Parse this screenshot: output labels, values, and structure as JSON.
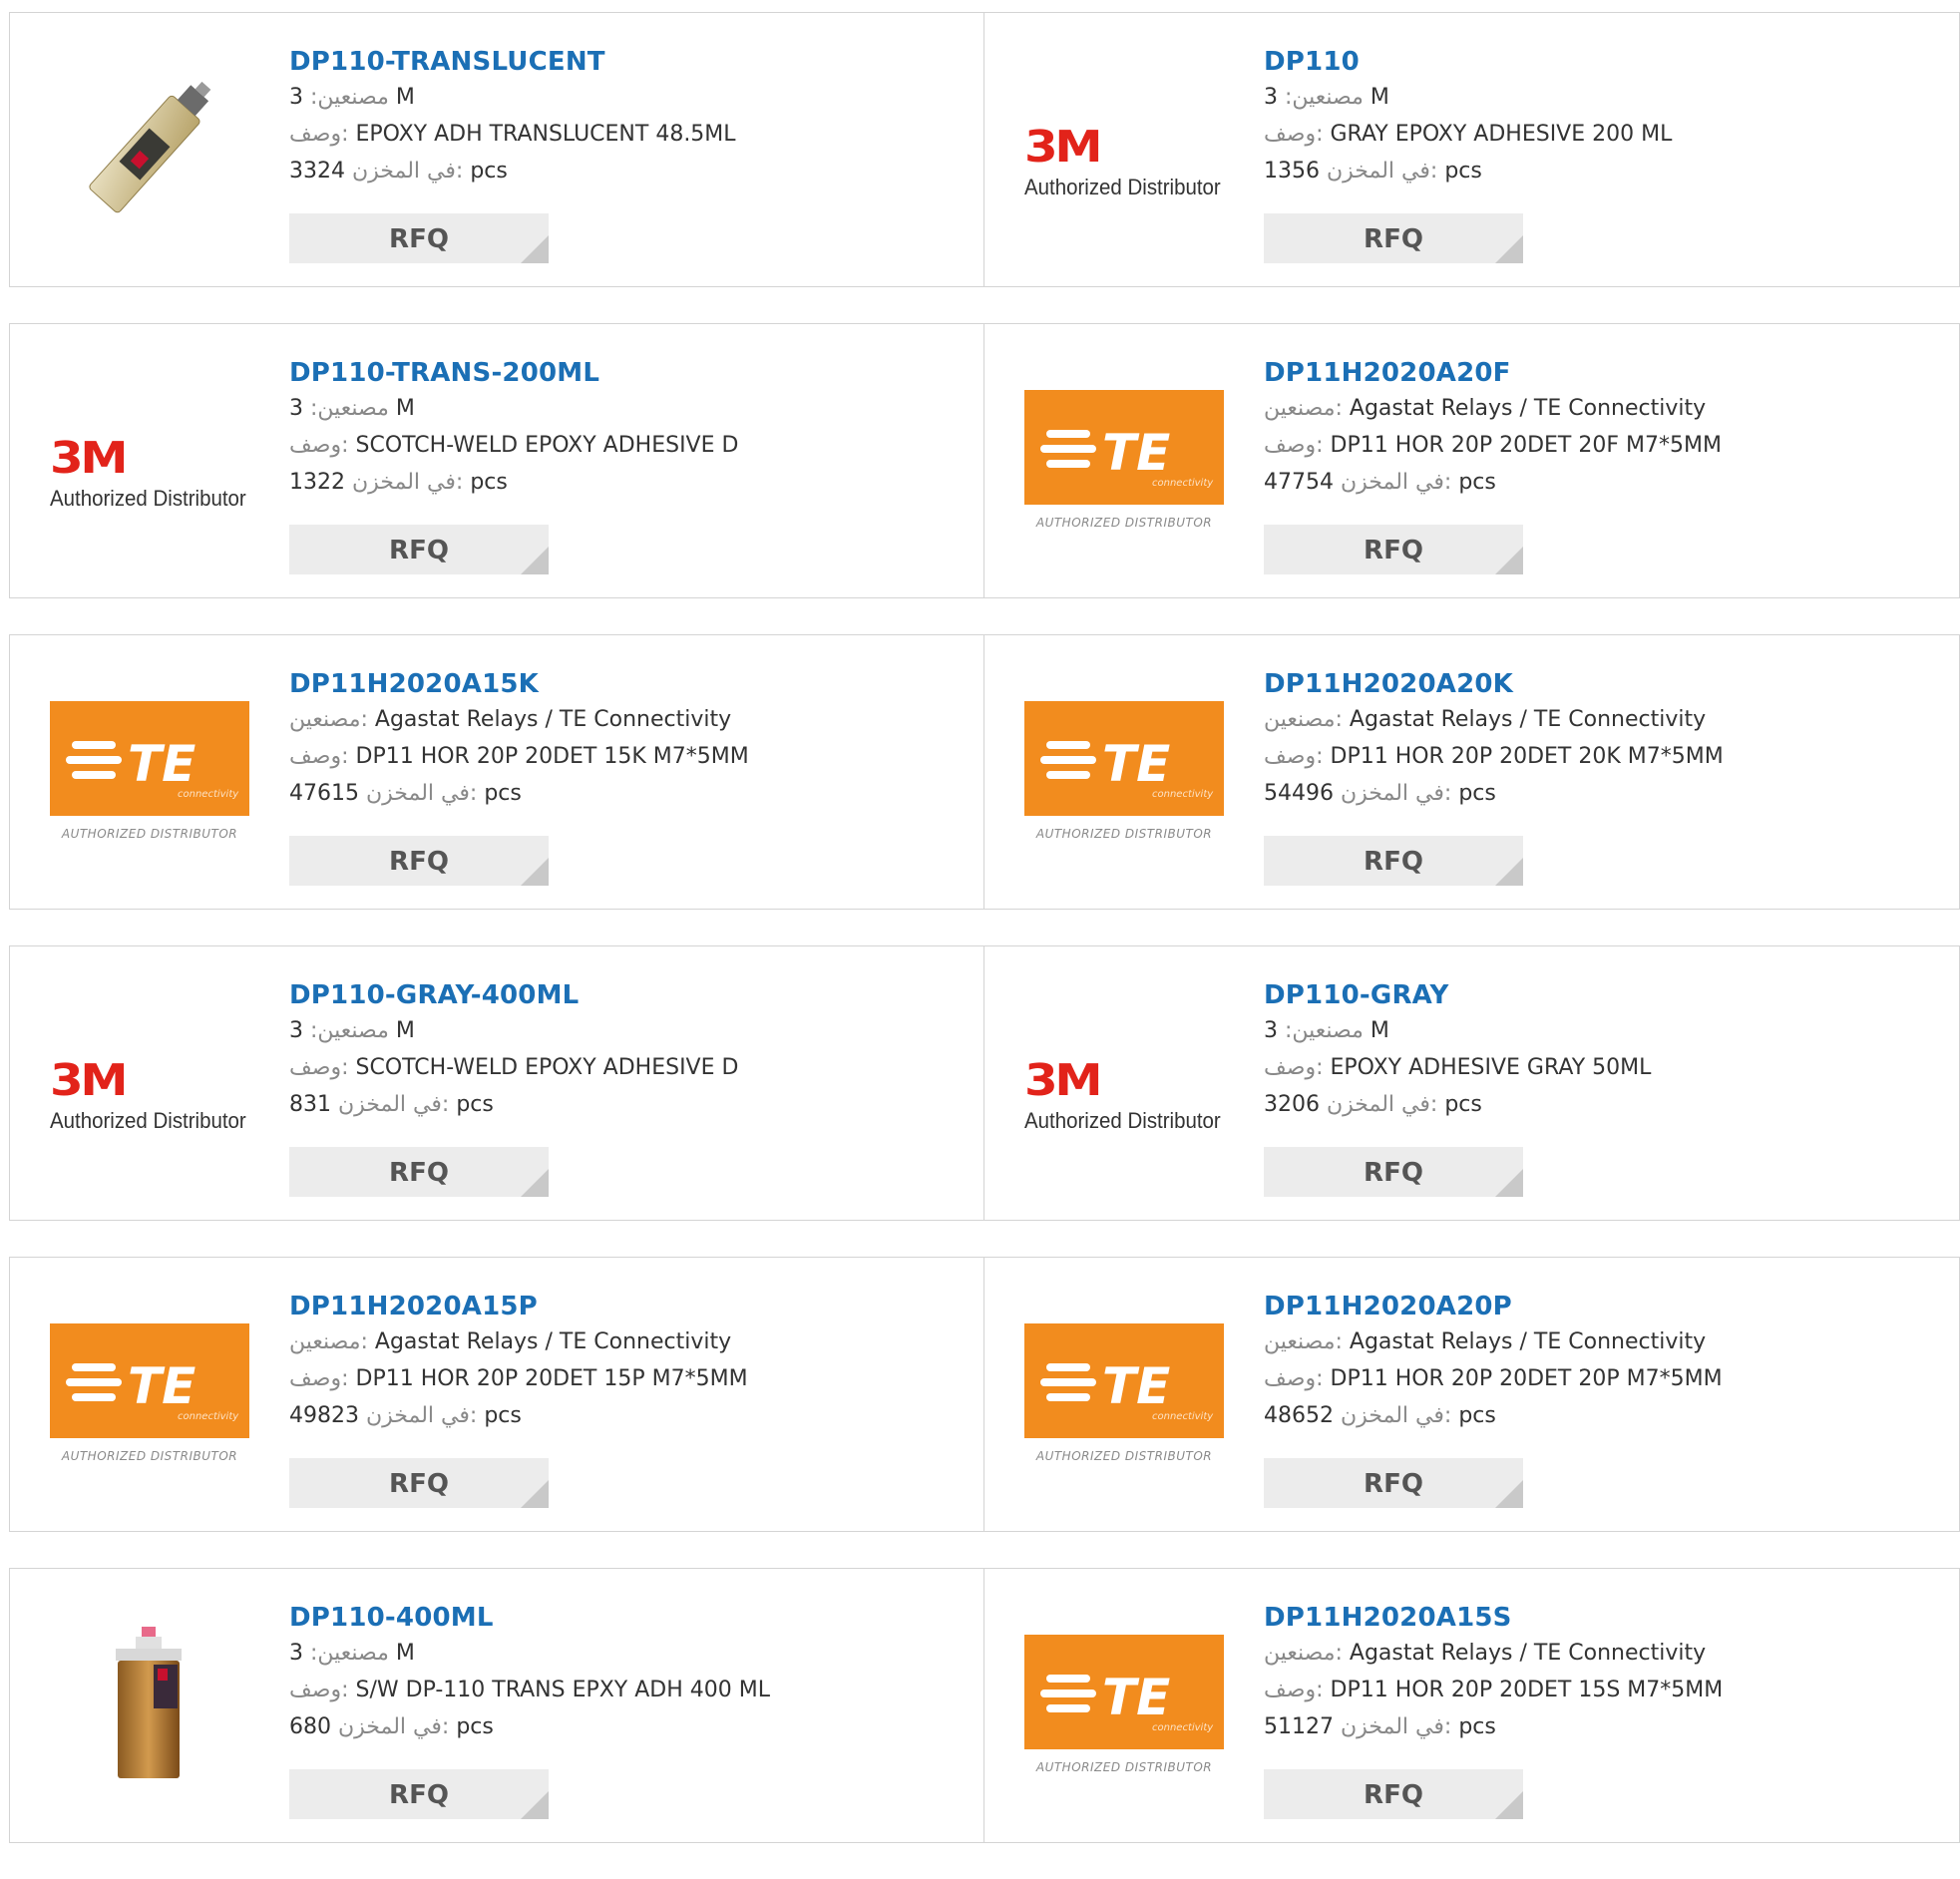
{
  "labels": {
    "manufacturer": "مصنعين:",
    "description": "وصف:",
    "stock": "في المخزن:",
    "unit": "pcs",
    "rfq": "RFQ"
  },
  "logos": {
    "3m_mark": "3M",
    "3m_caption": "Authorized Distributor",
    "te_mark": "TE",
    "te_sub": "connectivity",
    "te_caption": "AUTHORIZED DISTRIBUTOR"
  },
  "colors": {
    "part_number": "#1b6fb5",
    "te_orange": "#f28c1e",
    "3m_red": "#e2231a",
    "rfq_bg": "#ececec"
  },
  "products": [
    {
      "part": "DP110-TRANSLUCENT",
      "logo": "photo-cartridge",
      "mfr": "3 M",
      "desc": "EPOXY ADH TRANSLUCENT 48.5ML",
      "stock": "3324"
    },
    {
      "part": "DP110",
      "logo": "3m",
      "mfr": "3 M",
      "desc": "GRAY EPOXY ADHESIVE 200 ML",
      "stock": "1356"
    },
    {
      "part": "DP110-TRANS-200ML",
      "logo": "3m",
      "mfr": "3 M",
      "desc": "SCOTCH-WELD EPOXY ADHESIVE D",
      "stock": "1322"
    },
    {
      "part": "DP11H2020A20F",
      "logo": "te",
      "mfr": "Agastat Relays / TE Connectivity",
      "desc": "DP11 HOR 20P 20DET 20F M7*5MM",
      "stock": "47754"
    },
    {
      "part": "DP11H2020A15K",
      "logo": "te",
      "mfr": "Agastat Relays / TE Connectivity",
      "desc": "DP11 HOR 20P 20DET 15K M7*5MM",
      "stock": "47615"
    },
    {
      "part": "DP11H2020A20K",
      "logo": "te",
      "mfr": "Agastat Relays / TE Connectivity",
      "desc": "DP11 HOR 20P 20DET 20K M7*5MM",
      "stock": "54496"
    },
    {
      "part": "DP110-GRAY-400ML",
      "logo": "3m",
      "mfr": "3 M",
      "desc": "SCOTCH-WELD EPOXY ADHESIVE D",
      "stock": "831"
    },
    {
      "part": "DP110-GRAY",
      "logo": "3m",
      "mfr": "3 M",
      "desc": "EPOXY ADHESIVE GRAY 50ML",
      "stock": "3206"
    },
    {
      "part": "DP11H2020A15P",
      "logo": "te",
      "mfr": "Agastat Relays / TE Connectivity",
      "desc": "DP11 HOR 20P 20DET 15P M7*5MM",
      "stock": "49823"
    },
    {
      "part": "DP11H2020A20P",
      "logo": "te",
      "mfr": "Agastat Relays / TE Connectivity",
      "desc": "DP11 HOR 20P 20DET 20P M7*5MM",
      "stock": "48652"
    },
    {
      "part": "DP110-400ML",
      "logo": "photo-bottle",
      "mfr": "3 M",
      "desc": "S/W DP-110 TRANS EPXY ADH 400 ML",
      "stock": "680"
    },
    {
      "part": "DP11H2020A15S",
      "logo": "te",
      "mfr": "Agastat Relays / TE Connectivity",
      "desc": "DP11 HOR 20P 20DET 15S M7*5MM",
      "stock": "51127"
    }
  ]
}
